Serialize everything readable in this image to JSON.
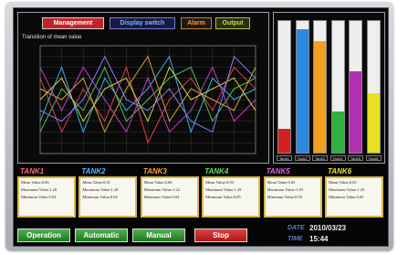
{
  "nav": {
    "management": "Management",
    "display_switch": "Display switch",
    "alarm": "Alarm",
    "output": "Output"
  },
  "graph": {
    "title": "Transition of mean value",
    "series": [
      {
        "color": "#e04040",
        "values": [
          7,
          2,
          6,
          3,
          8,
          1,
          5,
          7,
          4,
          8,
          6
        ]
      },
      {
        "color": "#3ab0e0",
        "values": [
          3,
          8,
          2,
          7,
          4,
          6,
          9,
          2,
          7,
          5,
          6
        ]
      },
      {
        "color": "#d0a030",
        "values": [
          6,
          5,
          7,
          2,
          6,
          9,
          3,
          6,
          5,
          4,
          8
        ]
      },
      {
        "color": "#50c050",
        "values": [
          2,
          6,
          4,
          8,
          3,
          5,
          7,
          8,
          3,
          6,
          7
        ]
      },
      {
        "color": "#c040c0",
        "values": [
          8,
          4,
          8,
          5,
          2,
          7,
          2,
          4,
          8,
          3,
          5
        ]
      },
      {
        "color": "#d8d040",
        "values": [
          5,
          7,
          3,
          6,
          7,
          3,
          8,
          5,
          6,
          7,
          4
        ]
      },
      {
        "color": "#8080ff",
        "values": [
          4,
          3,
          5,
          9,
          5,
          4,
          6,
          3,
          2,
          9,
          7
        ]
      }
    ]
  },
  "tanks": [
    {
      "name": "TANK1",
      "name_color": "#ff6a6a",
      "fill": 0.18,
      "fill_color": "#d42020",
      "btn": "Tank1",
      "mean": "Mean Value:0.06",
      "max": "Maximum Value:1.20",
      "min": "Minimum Value:0.03"
    },
    {
      "name": "TANK2",
      "name_color": "#5ab4ff",
      "fill": 0.94,
      "fill_color": "#2a8ae0",
      "btn": "Tank2",
      "mean": "Mean Value:0.01",
      "max": "Maximum Value:1.28",
      "min": "Minimum Value:0.02"
    },
    {
      "name": "TANK3",
      "name_color": "#ffa030",
      "fill": 0.85,
      "fill_color": "#f0a020",
      "btn": "Tank3",
      "mean": "Mean Value:0.06",
      "max": "Maximum Value:1.22",
      "min": "Minimum Value:0.04"
    },
    {
      "name": "TANK4",
      "name_color": "#60e060",
      "fill": 0.31,
      "fill_color": "#30b040",
      "btn": "Tank4",
      "mean": "Mean Value:0.03",
      "max": "Maximum Value:1.29",
      "min": "Minimum Value:0.05"
    },
    {
      "name": "TANK5",
      "name_color": "#e060e0",
      "fill": 0.62,
      "fill_color": "#b030b0",
      "btn": "Tank5",
      "mean": "Mean Value:0.05",
      "max": "Maximum Value:1.29",
      "min": "Minimum Value:0.05"
    },
    {
      "name": "TANK6",
      "name_color": "#f0e040",
      "fill": 0.45,
      "fill_color": "#e8e020",
      "btn": "Tank6",
      "mean": "Mean Value:0.05",
      "max": "Maximum Value:1.25",
      "min": "Minimum Value:0.05"
    }
  ],
  "controls": {
    "operation": "Operation",
    "automatic": "Automatic",
    "manual": "Manual",
    "stop": "Stop"
  },
  "datetime": {
    "date_label": "DATE",
    "date_value": "2010/03/23",
    "time_label": "TIME",
    "time_value": "15:44"
  }
}
